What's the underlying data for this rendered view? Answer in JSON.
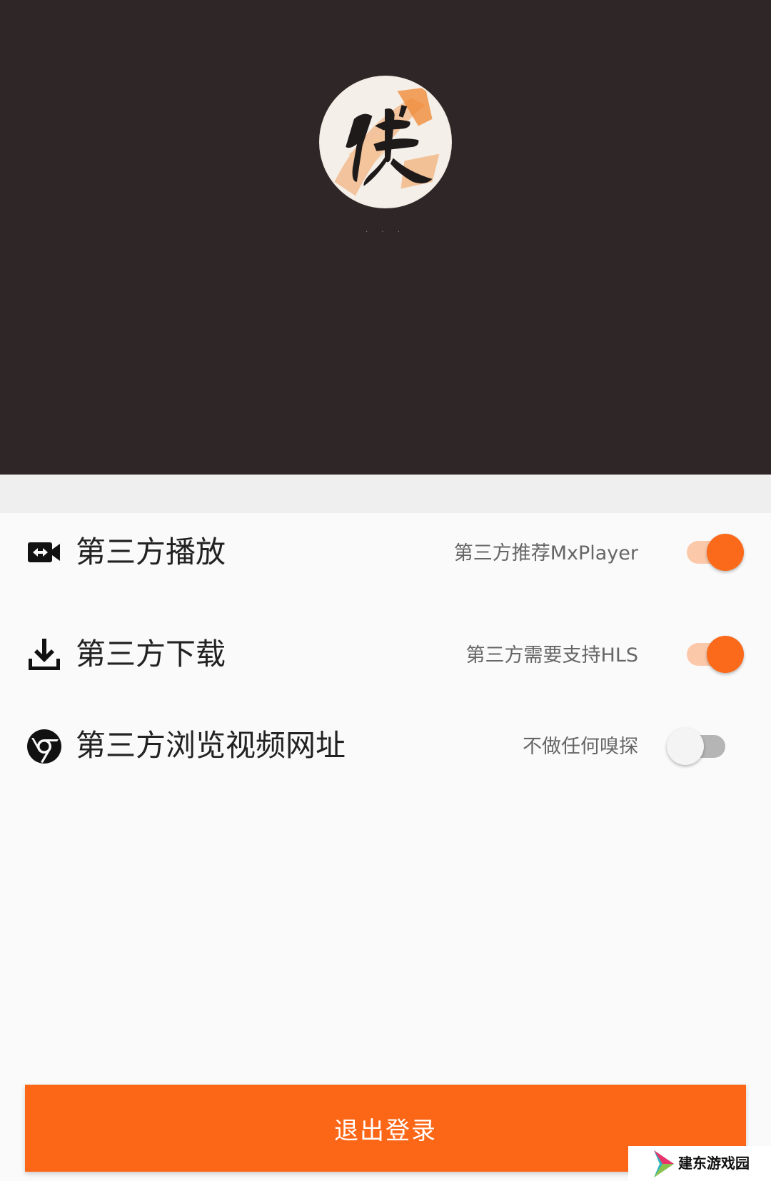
{
  "header": {
    "avatar_icon": "xia-character-logo-icon",
    "username": "· · ·",
    "background_color": "#2f2727"
  },
  "settings": [
    {
      "icon": "video-swap-icon",
      "title": "第三方播放",
      "hint": "第三方推荐MxPlayer",
      "enabled": true
    },
    {
      "icon": "download-icon",
      "title": "第三方下载",
      "hint": "第三方需要支持HLS",
      "enabled": true
    },
    {
      "icon": "chrome-icon",
      "title": "第三方浏览视频网址",
      "hint": "不做任何嗅探",
      "enabled": false
    }
  ],
  "logout_label": "退出登录",
  "watermark_label": "建东游戏园",
  "colors": {
    "accent": "#fc6617",
    "toggle_track_on": "#fbc9aa",
    "toggle_off": "#b5b5b5"
  }
}
